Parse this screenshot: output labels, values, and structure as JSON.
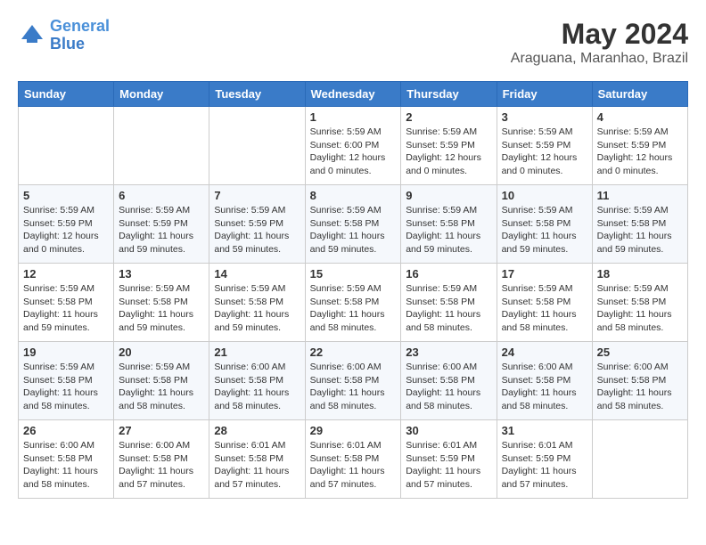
{
  "header": {
    "logo_line1": "General",
    "logo_line2": "Blue",
    "month": "May 2024",
    "location": "Araguana, Maranhao, Brazil"
  },
  "days_of_week": [
    "Sunday",
    "Monday",
    "Tuesday",
    "Wednesday",
    "Thursday",
    "Friday",
    "Saturday"
  ],
  "weeks": [
    [
      {
        "day": "",
        "info": ""
      },
      {
        "day": "",
        "info": ""
      },
      {
        "day": "",
        "info": ""
      },
      {
        "day": "1",
        "info": "Sunrise: 5:59 AM\nSunset: 6:00 PM\nDaylight: 12 hours\nand 0 minutes."
      },
      {
        "day": "2",
        "info": "Sunrise: 5:59 AM\nSunset: 5:59 PM\nDaylight: 12 hours\nand 0 minutes."
      },
      {
        "day": "3",
        "info": "Sunrise: 5:59 AM\nSunset: 5:59 PM\nDaylight: 12 hours\nand 0 minutes."
      },
      {
        "day": "4",
        "info": "Sunrise: 5:59 AM\nSunset: 5:59 PM\nDaylight: 12 hours\nand 0 minutes."
      }
    ],
    [
      {
        "day": "5",
        "info": "Sunrise: 5:59 AM\nSunset: 5:59 PM\nDaylight: 12 hours\nand 0 minutes."
      },
      {
        "day": "6",
        "info": "Sunrise: 5:59 AM\nSunset: 5:59 PM\nDaylight: 11 hours\nand 59 minutes."
      },
      {
        "day": "7",
        "info": "Sunrise: 5:59 AM\nSunset: 5:59 PM\nDaylight: 11 hours\nand 59 minutes."
      },
      {
        "day": "8",
        "info": "Sunrise: 5:59 AM\nSunset: 5:58 PM\nDaylight: 11 hours\nand 59 minutes."
      },
      {
        "day": "9",
        "info": "Sunrise: 5:59 AM\nSunset: 5:58 PM\nDaylight: 11 hours\nand 59 minutes."
      },
      {
        "day": "10",
        "info": "Sunrise: 5:59 AM\nSunset: 5:58 PM\nDaylight: 11 hours\nand 59 minutes."
      },
      {
        "day": "11",
        "info": "Sunrise: 5:59 AM\nSunset: 5:58 PM\nDaylight: 11 hours\nand 59 minutes."
      }
    ],
    [
      {
        "day": "12",
        "info": "Sunrise: 5:59 AM\nSunset: 5:58 PM\nDaylight: 11 hours\nand 59 minutes."
      },
      {
        "day": "13",
        "info": "Sunrise: 5:59 AM\nSunset: 5:58 PM\nDaylight: 11 hours\nand 59 minutes."
      },
      {
        "day": "14",
        "info": "Sunrise: 5:59 AM\nSunset: 5:58 PM\nDaylight: 11 hours\nand 59 minutes."
      },
      {
        "day": "15",
        "info": "Sunrise: 5:59 AM\nSunset: 5:58 PM\nDaylight: 11 hours\nand 58 minutes."
      },
      {
        "day": "16",
        "info": "Sunrise: 5:59 AM\nSunset: 5:58 PM\nDaylight: 11 hours\nand 58 minutes."
      },
      {
        "day": "17",
        "info": "Sunrise: 5:59 AM\nSunset: 5:58 PM\nDaylight: 11 hours\nand 58 minutes."
      },
      {
        "day": "18",
        "info": "Sunrise: 5:59 AM\nSunset: 5:58 PM\nDaylight: 11 hours\nand 58 minutes."
      }
    ],
    [
      {
        "day": "19",
        "info": "Sunrise: 5:59 AM\nSunset: 5:58 PM\nDaylight: 11 hours\nand 58 minutes."
      },
      {
        "day": "20",
        "info": "Sunrise: 5:59 AM\nSunset: 5:58 PM\nDaylight: 11 hours\nand 58 minutes."
      },
      {
        "day": "21",
        "info": "Sunrise: 6:00 AM\nSunset: 5:58 PM\nDaylight: 11 hours\nand 58 minutes."
      },
      {
        "day": "22",
        "info": "Sunrise: 6:00 AM\nSunset: 5:58 PM\nDaylight: 11 hours\nand 58 minutes."
      },
      {
        "day": "23",
        "info": "Sunrise: 6:00 AM\nSunset: 5:58 PM\nDaylight: 11 hours\nand 58 minutes."
      },
      {
        "day": "24",
        "info": "Sunrise: 6:00 AM\nSunset: 5:58 PM\nDaylight: 11 hours\nand 58 minutes."
      },
      {
        "day": "25",
        "info": "Sunrise: 6:00 AM\nSunset: 5:58 PM\nDaylight: 11 hours\nand 58 minutes."
      }
    ],
    [
      {
        "day": "26",
        "info": "Sunrise: 6:00 AM\nSunset: 5:58 PM\nDaylight: 11 hours\nand 58 minutes."
      },
      {
        "day": "27",
        "info": "Sunrise: 6:00 AM\nSunset: 5:58 PM\nDaylight: 11 hours\nand 57 minutes."
      },
      {
        "day": "28",
        "info": "Sunrise: 6:01 AM\nSunset: 5:58 PM\nDaylight: 11 hours\nand 57 minutes."
      },
      {
        "day": "29",
        "info": "Sunrise: 6:01 AM\nSunset: 5:58 PM\nDaylight: 11 hours\nand 57 minutes."
      },
      {
        "day": "30",
        "info": "Sunrise: 6:01 AM\nSunset: 5:59 PM\nDaylight: 11 hours\nand 57 minutes."
      },
      {
        "day": "31",
        "info": "Sunrise: 6:01 AM\nSunset: 5:59 PM\nDaylight: 11 hours\nand 57 minutes."
      },
      {
        "day": "",
        "info": ""
      }
    ]
  ]
}
